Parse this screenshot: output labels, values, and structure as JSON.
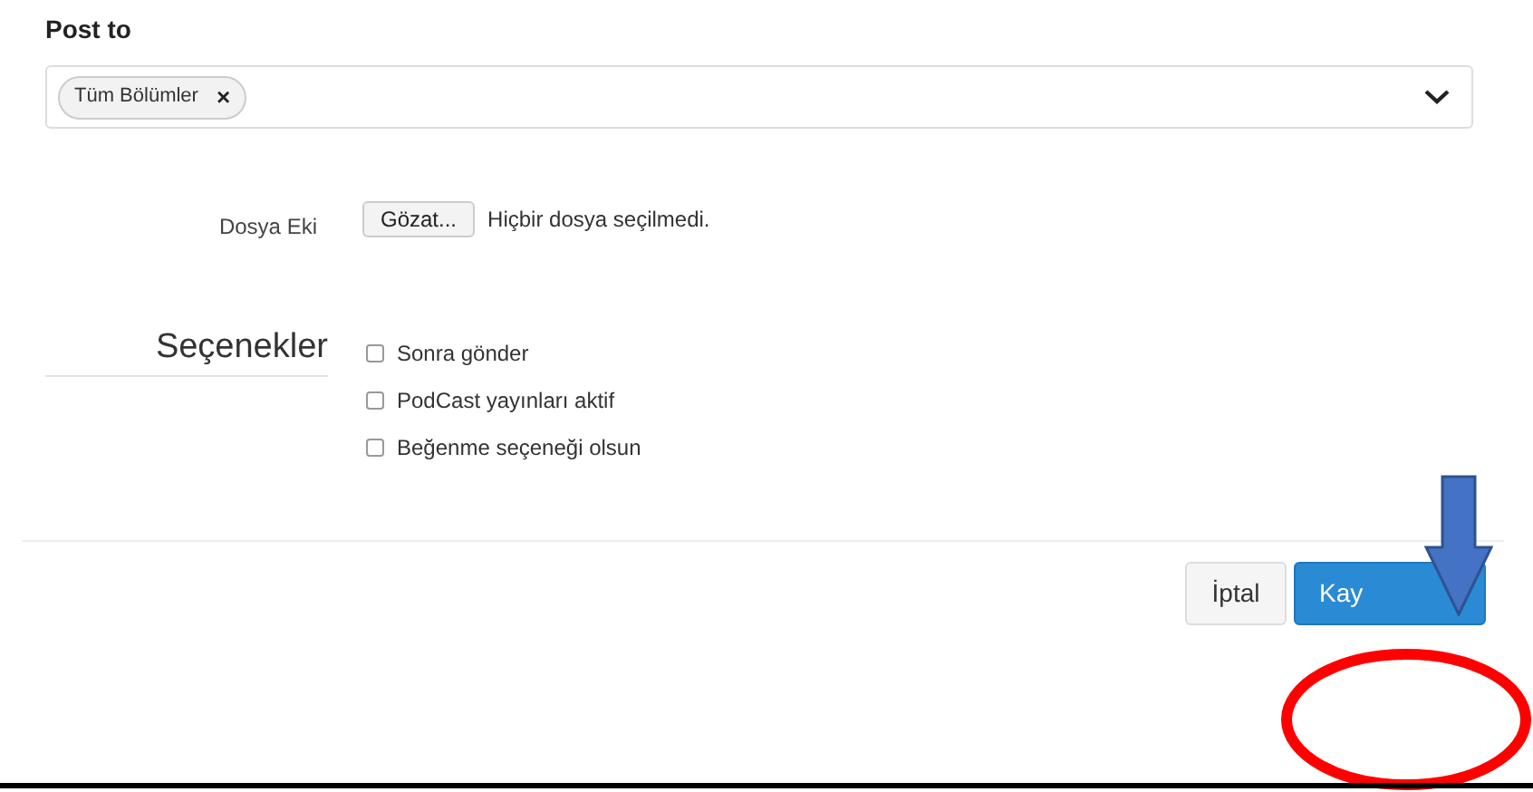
{
  "post_to": {
    "label": "Post to",
    "chips": [
      {
        "label": "Tüm Bölümler",
        "remove": "×"
      }
    ]
  },
  "attachment": {
    "label": "Dosya Eki",
    "button": "Gözat...",
    "status": "Hiçbir dosya seçilmedi."
  },
  "options": {
    "heading": "Seçenekler",
    "items": [
      {
        "label": "Sonra gönder",
        "checked": false
      },
      {
        "label": "PodCast yayınları aktif",
        "checked": false
      },
      {
        "label": "Beğenme seçeneği olsun",
        "checked": false
      }
    ]
  },
  "buttons": [
    {
      "label": "İptal",
      "kind": "secondary"
    },
    {
      "label": "Kay",
      "kind": "primary"
    }
  ]
}
